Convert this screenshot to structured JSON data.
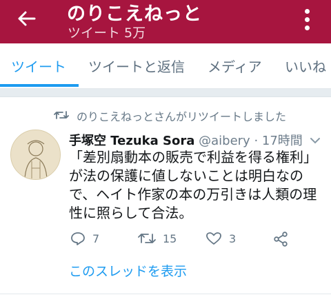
{
  "header": {
    "title": "のりこえねっと",
    "subtitle": "ツイート 5万",
    "back_icon": "arrow-left-icon",
    "more_icon": "vertical-dots-icon",
    "background": "#a7153f"
  },
  "tabs": [
    {
      "label": "ツイート",
      "active": true
    },
    {
      "label": "ツイートと返信",
      "active": false
    },
    {
      "label": "メディア",
      "active": false
    },
    {
      "label": "いいね",
      "active": false
    }
  ],
  "tweet": {
    "retweet_context": "のりこえねっとさんがリツイートしました",
    "author_name": "手塚空 Tezuka Sora",
    "author_handle": "@aibery",
    "time": "· 17時間",
    "text_lines": [
      "「差別扇動本の販売で利益を得る権利」",
      "が法の保護に値しないことは明白なの",
      "で、ヘイト作家の本の万引きは人類の理",
      "性に照らして合法。"
    ],
    "actions": {
      "reply_count": "7",
      "retweet_count": "15",
      "like_count": "3"
    },
    "thread_link": "このスレッドを表示"
  },
  "colors": {
    "accent": "#1d9bf0",
    "secondary_text": "#657786"
  }
}
